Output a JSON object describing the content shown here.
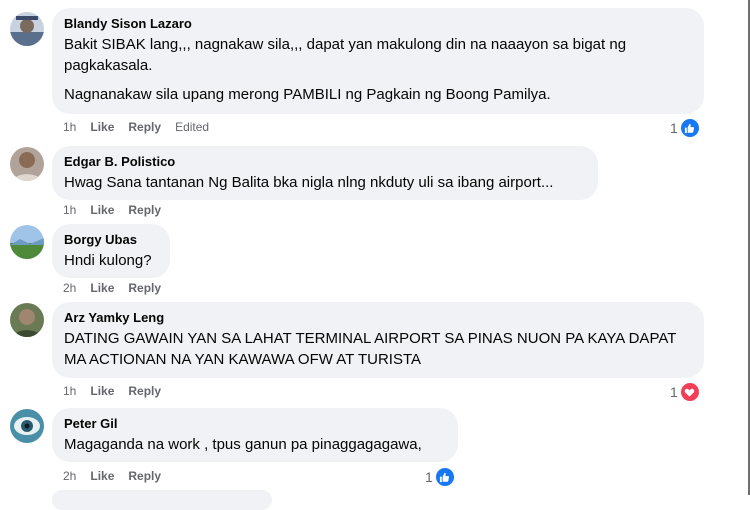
{
  "comments": [
    {
      "name": "Blandy Sison Lazaro",
      "lines": [
        "Bakit SIBAK lang,,, nagnakaw sila,,, dapat yan makulong din na naaayon sa bigat ng",
        "pagkakasala."
      ],
      "extra": "Nagnanakaw sila upang merong PAMBILI ng Pagkain ng Boong Pamilya.",
      "time": "1h",
      "like": "Like",
      "reply": "Reply",
      "edited": "Edited",
      "reaction": {
        "count": "1",
        "type": "like-icon",
        "color": "#1877f2"
      }
    },
    {
      "name": "Edgar B. Polistico",
      "lines": [
        "Hwag Sana tantanan Ng Balita bka nigla nlng nkduty uli sa ibang airport..."
      ],
      "time": "1h",
      "like": "Like",
      "reply": "Reply"
    },
    {
      "name": "Borgy Ubas",
      "lines": [
        "Hndi kulong?"
      ],
      "time": "2h",
      "like": "Like",
      "reply": "Reply"
    },
    {
      "name": "Arz Yamky Leng",
      "lines": [
        "DATING GAWAIN YAN SA LAHAT TERMINAL AIRPORT SA PINAS NUON PA KAYA DAPAT",
        "MA ACTIONAN NA YAN KAWAWA OFW AT TURISTA"
      ],
      "time": "1h",
      "like": "Like",
      "reply": "Reply",
      "reaction": {
        "count": "1",
        "type": "love-icon",
        "color": "#f33e58"
      }
    },
    {
      "name": "Peter Gil",
      "lines": [
        "Magaganda na work , tpus ganun pa pinaggagagawa,"
      ],
      "time": "2h",
      "like": "Like",
      "reply": "Reply",
      "reaction": {
        "count": "1",
        "type": "like-icon",
        "color": "#1877f2"
      }
    }
  ]
}
